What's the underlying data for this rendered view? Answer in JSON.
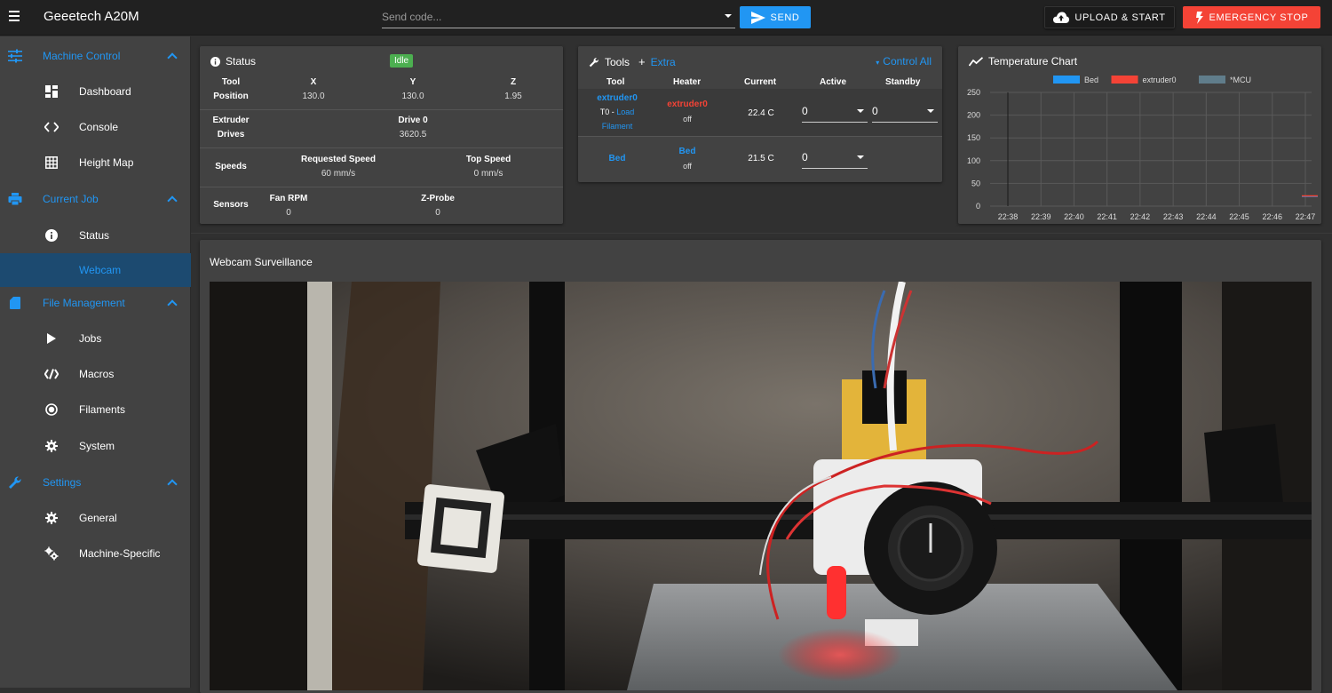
{
  "app": {
    "title": "Geeetech A20M"
  },
  "toolbar": {
    "send_placeholder": "Send code...",
    "send_label": "SEND",
    "upload_label": "UPLOAD & START",
    "estop_label": "EMERGENCY STOP"
  },
  "sidebar": {
    "groups": [
      {
        "label": "Machine Control",
        "icon": "tune-icon",
        "items": [
          {
            "label": "Dashboard",
            "icon": "dashboard-icon"
          },
          {
            "label": "Console",
            "icon": "code-icon"
          },
          {
            "label": "Height Map",
            "icon": "grid-icon"
          }
        ]
      },
      {
        "label": "Current Job",
        "icon": "printer-icon",
        "items": [
          {
            "label": "Status",
            "icon": "info-icon"
          },
          {
            "label": "Webcam",
            "icon": "",
            "active": true
          }
        ]
      },
      {
        "label": "File Management",
        "icon": "sd-card-icon",
        "items": [
          {
            "label": "Jobs",
            "icon": "play-icon"
          },
          {
            "label": "Macros",
            "icon": "macro-icon"
          },
          {
            "label": "Filaments",
            "icon": "radio-icon"
          },
          {
            "label": "System",
            "icon": "gear-icon"
          }
        ]
      },
      {
        "label": "Settings",
        "icon": "wrench-icon",
        "items": [
          {
            "label": "General",
            "icon": "gear-icon"
          },
          {
            "label": "Machine-Specific",
            "icon": "gears-icon"
          }
        ]
      }
    ]
  },
  "status": {
    "title": "Status",
    "badge": "Idle",
    "position": {
      "row_label_1": "Tool",
      "row_label_2": "Position",
      "cols": [
        {
          "h": "X",
          "v": "130.0"
        },
        {
          "h": "Y",
          "v": "130.0"
        },
        {
          "h": "Z",
          "v": "1.95"
        }
      ]
    },
    "extruder": {
      "row_label_1": "Extruder",
      "row_label_2": "Drives",
      "h": "Drive 0",
      "v": "3620.5"
    },
    "speeds": {
      "row_label": "Speeds",
      "cols": [
        {
          "h": "Requested Speed",
          "v": "60 mm/s"
        },
        {
          "h": "Top Speed",
          "v": "0 mm/s"
        }
      ]
    },
    "sensors": {
      "row_label": "Sensors",
      "cols": [
        {
          "h": "Fan RPM",
          "v": "0"
        },
        {
          "h": "Z-Probe",
          "v": "0"
        }
      ]
    }
  },
  "tools": {
    "title": "Tools",
    "extra": "Extra",
    "control_all": "Control All",
    "headers": {
      "tool": "Tool",
      "heater": "Heater",
      "current": "Current",
      "active": "Active",
      "standby": "Standby"
    },
    "rows": [
      {
        "tool": "extruder0",
        "tool_sub_1": "T0 - ",
        "tool_sub_link": "Load",
        "tool_sub_2": "Filament",
        "heater": "extruder0",
        "heater_state": "off",
        "current": "22.4 C",
        "active": "0",
        "standby": "0"
      },
      {
        "tool": "Bed",
        "heater": "Bed",
        "heater_state": "off",
        "current": "21.5 C",
        "active": "0"
      }
    ]
  },
  "temp_chart": {
    "title": "Temperature Chart"
  },
  "chart_data": {
    "type": "line",
    "title": "",
    "x": [
      "22:38",
      "22:39",
      "22:40",
      "22:41",
      "22:42",
      "22:43",
      "22:44",
      "22:45",
      "22:46",
      "22:47"
    ],
    "ylim": [
      0,
      250
    ],
    "yticks": [
      0,
      50,
      100,
      150,
      200,
      250
    ],
    "grid": true,
    "legend": "top",
    "series": [
      {
        "name": "Bed",
        "color": "#2196f3",
        "values": [
          null,
          null,
          null,
          null,
          null,
          null,
          null,
          null,
          null,
          21.5
        ]
      },
      {
        "name": "extruder0",
        "color": "#f44336",
        "values": [
          null,
          null,
          null,
          null,
          null,
          null,
          null,
          null,
          null,
          22.4
        ]
      },
      {
        "name": "*MCU",
        "color": "#607d8b",
        "values": []
      }
    ]
  },
  "webcam": {
    "title": "Webcam Surveillance"
  }
}
